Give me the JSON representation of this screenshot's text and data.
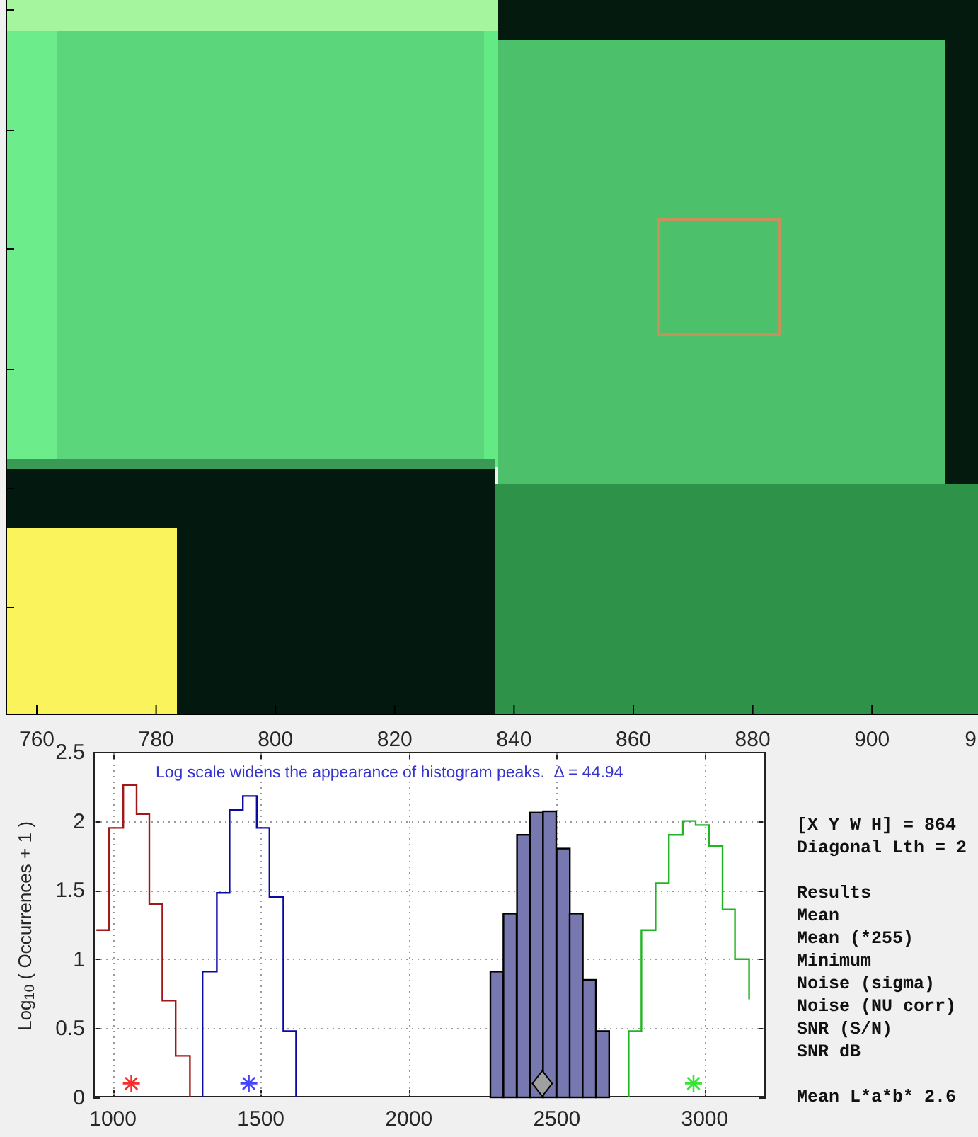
{
  "image": {
    "x_tick_labels": [
      "760",
      "780",
      "800",
      "820",
      "840",
      "860",
      "880",
      "900",
      "9"
    ]
  },
  "histogram": {
    "chart_data": {
      "type": "bar",
      "ylabel": "Log$_{10}$ ( Occurrences + 1 )",
      "xlim": [
        934,
        3206
      ],
      "ylim": [
        0,
        2.5
      ],
      "xticks": [
        1000,
        1500,
        2000,
        2500,
        3000
      ],
      "yticks": [
        0,
        0.5,
        1,
        1.5,
        2,
        2.5
      ],
      "grid": true,
      "annotations": [
        "Log scale widens the appearance of histogram peaks.  Δ = 44.94"
      ],
      "series": [
        {
          "type": "line",
          "color": "#a01818",
          "x": [
            944,
            987,
            987,
            1035,
            1035,
            1080,
            1080,
            1123,
            1123,
            1167,
            1167,
            1212,
            1212,
            1260,
            1260
          ],
          "values": [
            1.21,
            1.21,
            1.95,
            1.95,
            2.26,
            2.26,
            2.05,
            2.05,
            1.4,
            1.4,
            0.7,
            0.7,
            0.3,
            0.3,
            0
          ]
        },
        {
          "type": "line",
          "color": "#0a0aa0",
          "x": [
            1303,
            1303,
            1351,
            1351,
            1394,
            1394,
            1439,
            1439,
            1486,
            1486,
            1529,
            1529,
            1576,
            1576,
            1619,
            1619
          ],
          "values": [
            0,
            0.91,
            0.91,
            1.48,
            1.48,
            2.08,
            2.08,
            2.18,
            2.18,
            1.95,
            1.95,
            1.45,
            1.45,
            0.48,
            0.48,
            0
          ]
        },
        {
          "color": "#7878b0",
          "x": [
            2298,
            2342,
            2388,
            2432,
            2476,
            2522,
            2566,
            2610,
            2655
          ],
          "values": [
            0.91,
            1.33,
            1.9,
            2.06,
            2.07,
            1.8,
            1.33,
            0.85,
            0.48
          ]
        },
        {
          "type": "line",
          "color": "#22b422",
          "x": [
            2743,
            2743,
            2786,
            2786,
            2834,
            2834,
            2879,
            2879,
            2926,
            2926,
            2969,
            2969,
            3014,
            3014,
            3060,
            3060,
            3102,
            3102,
            3150,
            3150
          ],
          "values": [
            0,
            0.48,
            0.48,
            1.21,
            1.21,
            1.55,
            1.55,
            1.9,
            1.9,
            2.0,
            2.0,
            1.97,
            1.97,
            1.82,
            1.82,
            1.36,
            1.36,
            1.0,
            1.0,
            0.71
          ]
        },
        {
          "type": "scatter",
          "marker": "cross",
          "color": "#ff2a2a",
          "x": [
            1062
          ],
          "values": [
            0.1
          ]
        },
        {
          "type": "scatter",
          "marker": "cross",
          "color": "#4545ff",
          "x": [
            1459
          ],
          "values": [
            0.1
          ]
        },
        {
          "type": "scatter",
          "marker": "diamond",
          "color": "#a0a0a0",
          "x": [
            2451
          ],
          "values": [
            0.1
          ]
        },
        {
          "type": "scatter",
          "marker": "cross",
          "color": "#2ee82e",
          "x": [
            2962
          ],
          "values": [
            0.1
          ]
        }
      ]
    }
  },
  "results_panel": {
    "selection_lines": [
      "[X Y W H] = 864",
      "Diagonal Lth = 2"
    ],
    "heading": "Results",
    "rows": [
      "Mean",
      "Mean (*255)",
      "Minimum",
      "Noise (sigma)",
      "Noise (NU corr)",
      "SNR (S/N)",
      "SNR dB"
    ],
    "footer": "Mean L*a*b* 2.6"
  }
}
